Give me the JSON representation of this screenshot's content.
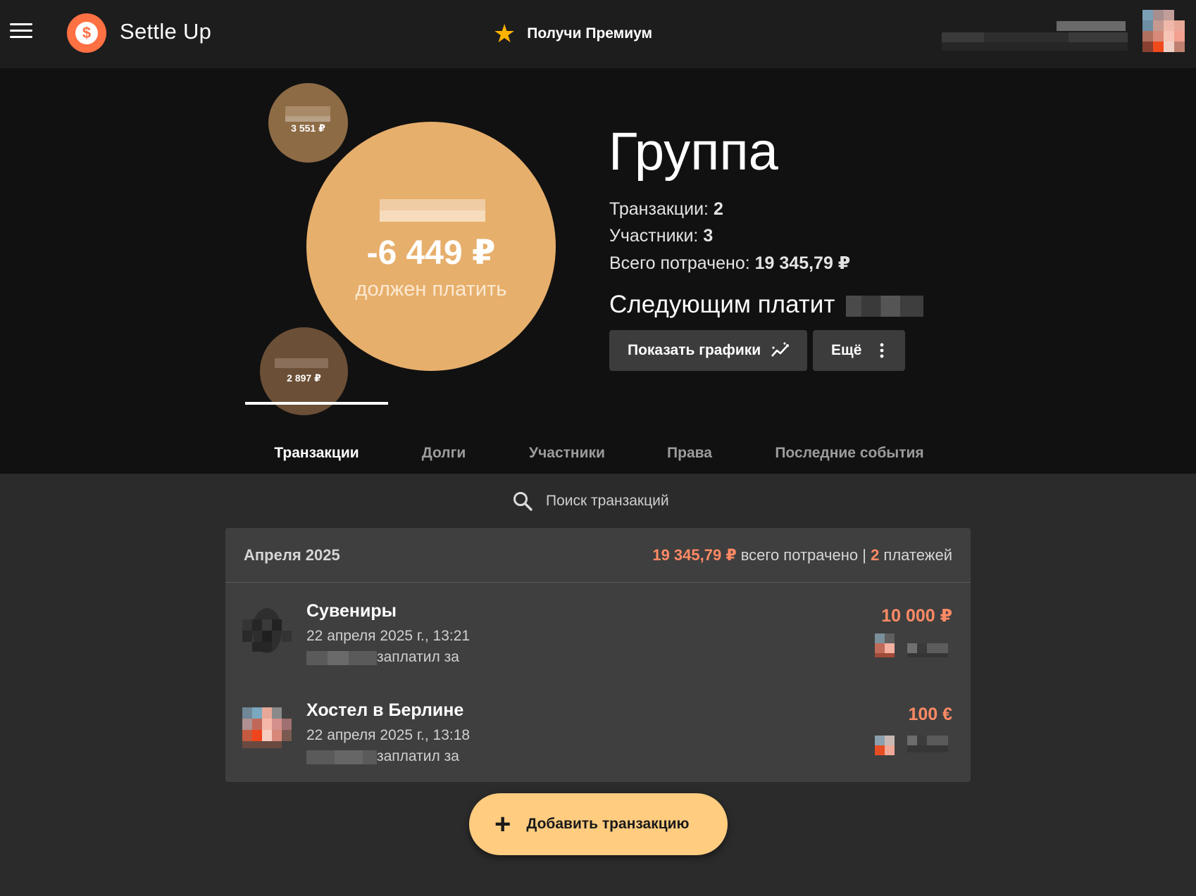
{
  "app": {
    "title": "Settle Up",
    "premium_label": "Получи Премиум"
  },
  "balances": {
    "main_amount": "-6 449 ₽",
    "main_status": "должен платить",
    "member_2_amount": "3 551 ₽",
    "member_3_amount": "2 897 ₽"
  },
  "group": {
    "name": "Группа",
    "transactions_label": "Транзакции:",
    "transactions_count": "2",
    "members_label": "Участники:",
    "members_count": "3",
    "total_label": "Всего потрачено:",
    "total_value": "19 345,79 ₽",
    "next_payer_label": "Следующим платит",
    "charts_button": "Показать графики",
    "more_button": "Ещё"
  },
  "tabs": [
    {
      "label": "Транзакции",
      "active": true
    },
    {
      "label": "Долги",
      "active": false
    },
    {
      "label": "Участники",
      "active": false
    },
    {
      "label": "Права",
      "active": false
    },
    {
      "label": "Последние события",
      "active": false
    }
  ],
  "search": {
    "placeholder": "Поиск транзакций"
  },
  "month_group": {
    "month": "Апреля 2025",
    "total": "19 345,79 ₽",
    "total_suffix": " всего потрачено | ",
    "count": "2",
    "count_suffix": " платежей"
  },
  "transactions": [
    {
      "title": "Сувениры",
      "date": "22 апреля 2025 г., 13:21",
      "payer_suffix": "заплатил за",
      "amount": "10 000 ₽"
    },
    {
      "title": "Хостел в Берлине",
      "date": "22 апреля 2025 г., 13:18",
      "payer_suffix": "заплатил за",
      "amount": "100 €"
    }
  ],
  "fab": {
    "label": "Добавить транзакцию"
  },
  "colors": {
    "accent": "#ff8a65",
    "logo": "#ff7043",
    "fab": "#ffcc80",
    "main_bubble": "#e7af6c",
    "premium_star": "#ffb300"
  },
  "icons": {
    "menu": "hamburger-icon",
    "logo": "dollar-coin-icon",
    "premium": "star-icon",
    "charts": "trending-chart-icon",
    "more": "vertical-dots-icon",
    "search": "search-icon",
    "add": "plus-icon"
  }
}
